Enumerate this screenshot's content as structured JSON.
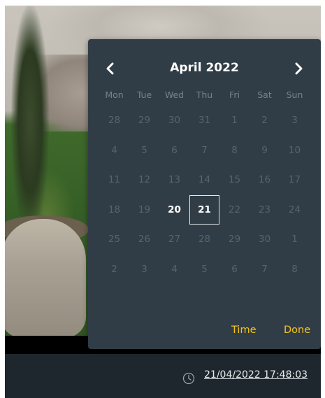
{
  "calendar": {
    "month_title": "April 2022",
    "prev_icon": "chevron-left-icon",
    "next_icon": "chevron-right-icon",
    "weekdays": [
      "Mon",
      "Tue",
      "Wed",
      "Thu",
      "Fri",
      "Sat",
      "Sun"
    ],
    "weeks": [
      [
        "28",
        "29",
        "30",
        "31",
        "1",
        "2",
        "3"
      ],
      [
        "4",
        "5",
        "6",
        "7",
        "8",
        "9",
        "10"
      ],
      [
        "11",
        "12",
        "13",
        "14",
        "15",
        "16",
        "17"
      ],
      [
        "18",
        "19",
        "20",
        "21",
        "22",
        "23",
        "24"
      ],
      [
        "25",
        "26",
        "27",
        "28",
        "29",
        "30",
        "1"
      ],
      [
        "2",
        "3",
        "4",
        "5",
        "6",
        "7",
        "8"
      ]
    ],
    "highlighted_day": "20",
    "selected_day": "21",
    "time_label": "Time",
    "done_label": "Done"
  },
  "status_bar": {
    "clock_icon": "clock-icon",
    "timestamp": "21/04/2022 17:48:03"
  },
  "colors": {
    "panel_bg": "#313d46",
    "accent": "#f2c31c",
    "muted_day": "#56646d",
    "weekday": "#76838c"
  }
}
